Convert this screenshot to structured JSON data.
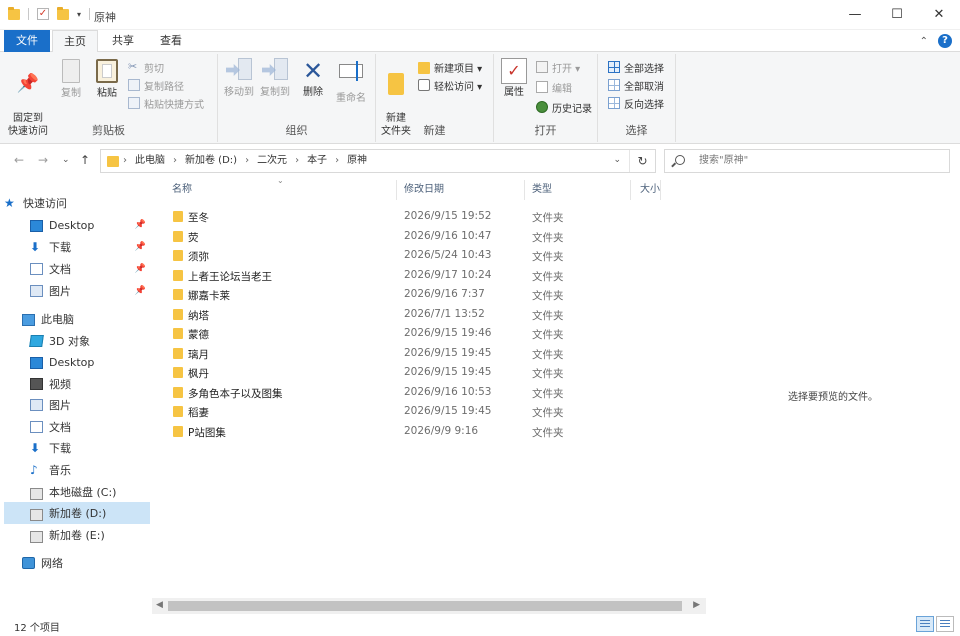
{
  "window": {
    "title": "原神",
    "minimize": "—",
    "maximize": "☐",
    "close": "✕"
  },
  "ribbon_tabs": {
    "file": "文件",
    "home": "主页",
    "share": "共享",
    "view": "查看"
  },
  "ribbon": {
    "clipboard": {
      "label": "剪贴板",
      "pin_quick_access": "固定到\n快速访问",
      "copy": "复制",
      "paste": "粘贴",
      "cut": "剪切",
      "copy_path": "复制路径",
      "paste_shortcut": "粘贴快捷方式"
    },
    "organize": {
      "label": "组织",
      "move_to": "移动到",
      "copy_to": "复制到",
      "delete": "删除",
      "rename": "重命名"
    },
    "new": {
      "label": "新建",
      "new_folder": "新建\n文件夹",
      "new_item": "新建项目 ▾",
      "easy_access": "轻松访问 ▾"
    },
    "open": {
      "label": "打开",
      "properties": "属性",
      "open": "打开 ▾",
      "edit": "编辑",
      "history": "历史记录"
    },
    "select": {
      "label": "选择",
      "select_all": "全部选择",
      "select_none": "全部取消",
      "invert": "反向选择"
    }
  },
  "address": {
    "breadcrumbs": [
      "此电脑",
      "新加卷 (D:)",
      "二次元",
      "本子",
      "原神"
    ],
    "search_placeholder": "搜索\"原神\""
  },
  "nav_pane": {
    "quick_access": "快速访问",
    "quick_items": [
      "Desktop",
      "下载",
      "文档",
      "图片"
    ],
    "this_pc": "此电脑",
    "pc_items": [
      "3D 对象",
      "Desktop",
      "视频",
      "图片",
      "文档",
      "下载",
      "音乐",
      "本地磁盘 (C:)",
      "新加卷 (D:)",
      "新加卷 (E:)"
    ],
    "network": "网络"
  },
  "columns": {
    "name": "名称",
    "date": "修改日期",
    "type": "类型",
    "size": "大小"
  },
  "files": [
    {
      "name": "至冬",
      "date": "2026/9/15 19:52",
      "type": "文件夹"
    },
    {
      "name": "荧",
      "date": "2026/9/16 10:47",
      "type": "文件夹"
    },
    {
      "name": "须弥",
      "date": "2026/5/24 10:43",
      "type": "文件夹"
    },
    {
      "name": "上者王论坛当老王",
      "date": "2026/9/17 10:24",
      "type": "文件夹"
    },
    {
      "name": "娜嘉卡莱",
      "date": "2026/9/16 7:37",
      "type": "文件夹"
    },
    {
      "name": "纳塔",
      "date": "2026/7/1 13:52",
      "type": "文件夹"
    },
    {
      "name": "蒙德",
      "date": "2026/9/15 19:46",
      "type": "文件夹"
    },
    {
      "name": "璃月",
      "date": "2026/9/15 19:45",
      "type": "文件夹"
    },
    {
      "name": "枫丹",
      "date": "2026/9/15 19:45",
      "type": "文件夹"
    },
    {
      "name": "多角色本子以及图集",
      "date": "2026/9/16 10:53",
      "type": "文件夹"
    },
    {
      "name": "稻妻",
      "date": "2026/9/15 19:45",
      "type": "文件夹"
    },
    {
      "name": "P站图集",
      "date": "2026/9/9 9:16",
      "type": "文件夹"
    }
  ],
  "preview": {
    "empty_text": "选择要预览的文件。"
  },
  "status": {
    "item_count": "12 个项目"
  }
}
